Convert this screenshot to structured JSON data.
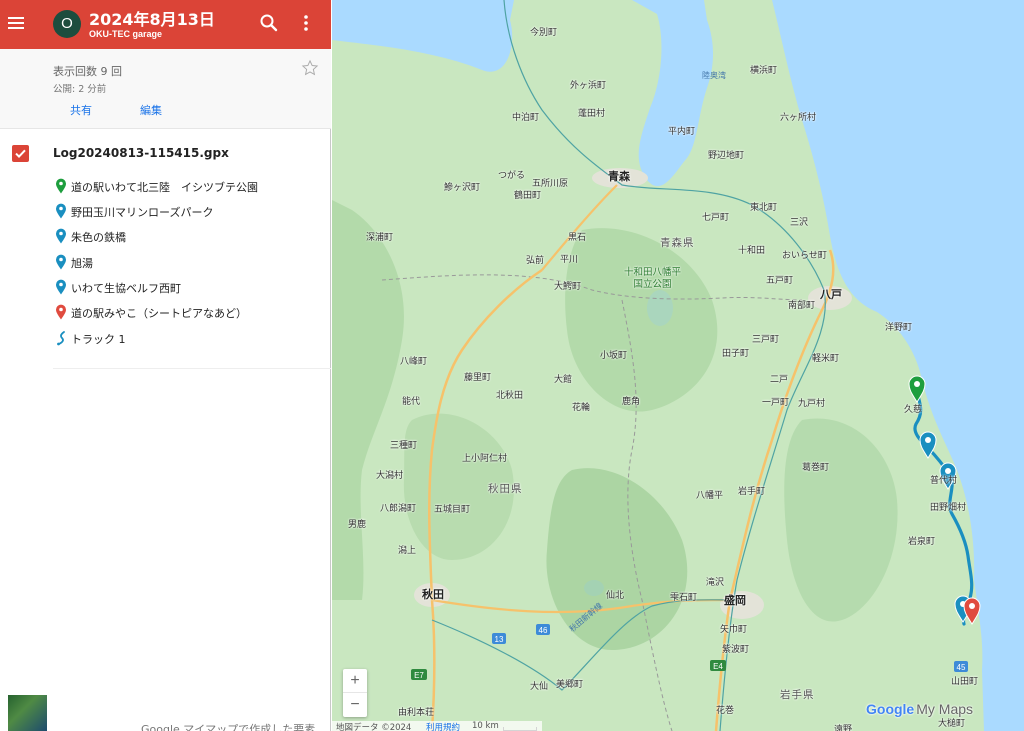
{
  "header": {
    "avatar_letter": "O",
    "title": "2024年8月13日",
    "subtitle": "OKU-TEC garage",
    "color": "#db4437"
  },
  "info": {
    "views": "表示回数 9 回",
    "published": "公開: 2 分前",
    "share_label": "共有",
    "edit_label": "編集"
  },
  "layer": {
    "name": "Log20240813-115415.gpx",
    "checked": true,
    "features": [
      {
        "label": "道の駅いわて北三陸　イシツブテ公園",
        "icon": "green-marker-icon",
        "color": "#1e9e3e"
      },
      {
        "label": "野田玉川マリンローズパーク",
        "icon": "blue-marker-icon",
        "color": "#1a8fc0"
      },
      {
        "label": "朱色の鉄橋",
        "icon": "blue-marker-icon",
        "color": "#1a8fc0"
      },
      {
        "label": "旭湯",
        "icon": "blue-marker-icon",
        "color": "#1a8fc0"
      },
      {
        "label": "いわて生協ベルフ西町",
        "icon": "blue-marker-icon",
        "color": "#1a8fc0"
      },
      {
        "label": "道の駅みやこ（シートピアなあど）",
        "icon": "red-marker-icon",
        "color": "#e04b3f"
      },
      {
        "label": "トラック 1",
        "icon": "track-line-icon",
        "color": "#1a8fc0"
      }
    ]
  },
  "footer": {
    "text": "Google マイマップで作成した要素"
  },
  "map": {
    "places": {
      "imabetsu": "今別町",
      "sotogahama": "外ヶ浜町",
      "yomogita": "蓬田村",
      "nakadomari": "中泊町",
      "tsugaru": "つがる",
      "goshogawara": "五所川原",
      "ajigasawa": "鰺ヶ沢町",
      "tsuruta": "鶴田町",
      "aomori": "青森",
      "hiranai": "平内町",
      "noheji": "野辺地町",
      "yokohama": "横浜町",
      "rokkasho": "六ヶ所村",
      "tohoku": "東北町",
      "shichinohe": "七戸町",
      "misawa": "三沢",
      "towada": "十和田",
      "oirase": "おいらせ町",
      "aomori_pref": "青森県",
      "fukaura": "深浦町",
      "hirosaki": "弘前",
      "kuroishi": "黒石",
      "hiraka": "平川",
      "owani": "大鰐町",
      "towada_park": "十和田八幡平\n国立公園",
      "gonohe": "五戸町",
      "hachinohe": "八戸",
      "nanbu": "南部町",
      "sannohe": "三戸町",
      "hashikami": "洋野町",
      "happo": "八峰町",
      "kosaka": "小坂町",
      "takko": "田子町",
      "karumai": "軽米町",
      "fujisato": "藤里町",
      "odate": "大館",
      "ninohe": "二戸",
      "kuji": "久慈",
      "noshiro": "能代",
      "kitaakita": "北秋田",
      "hanawa": "花輪",
      "kazuno": "鹿角",
      "ichinohe": "一戸町",
      "kunohe": "九戸村",
      "mitane": "三種町",
      "kamikoani": "上小阿仁村",
      "kuzumaki": "葛巻町",
      "fudai": "普代村",
      "ogata": "大潟村",
      "akita_pref": "秋田県",
      "hachimantai": "八幡平",
      "iwate_town": "岩手町",
      "tanohata": "田野畑村",
      "hachirogata": "八郎潟町",
      "gojome": "五城目町",
      "oga": "男鹿",
      "katagami": "潟上",
      "iwaizumi": "岩泉町",
      "akita": "秋田",
      "senboku": "仙北",
      "shizukuishi": "雫石町",
      "takizawa": "滝沢",
      "morioka": "盛岡",
      "yahaba": "矢巾町",
      "shiwa": "紫波町",
      "daisen": "大仙",
      "misato": "美郷町",
      "yamada": "山田町",
      "iwate_pref": "岩手県",
      "yurihonjo": "由利本荘",
      "hanamaki": "花巻",
      "otsuchi": "大槌町",
      "tono": "遠野",
      "mutsu_bay": "陸奥湾",
      "shinkansen": "秋田新幹線"
    },
    "routes": {
      "r13": "13",
      "r46": "46",
      "r45": "45",
      "e7": "E7",
      "e4": "E4"
    },
    "zoom_in": "+",
    "zoom_out": "−",
    "logo_google": "Google",
    "logo_mymaps": "My Maps",
    "attribution": "地図データ ©2024",
    "terms": "利用規約",
    "scale": "10 km"
  }
}
